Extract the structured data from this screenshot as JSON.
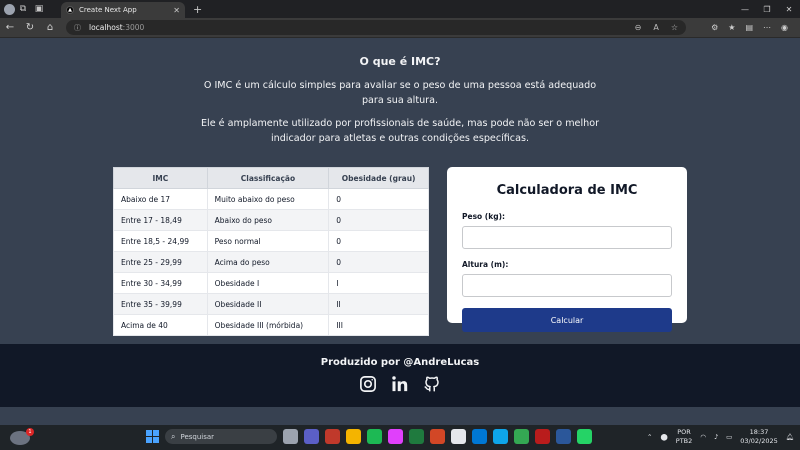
{
  "browser": {
    "tab_title": "Create Next App",
    "tab_favicon": "▲",
    "url_host": "localhost",
    "url_port": ":3000"
  },
  "intro": {
    "heading": "O que é IMC?",
    "paragraph1": "O IMC é um cálculo simples para avaliar se o peso de uma pessoa está adequado para sua altura.",
    "paragraph2": "Ele é amplamente utilizado por profissionais de saúde, mas pode não ser o melhor indicador para atletas e outras condições específicas."
  },
  "table": {
    "headers": [
      "IMC",
      "Classificação",
      "Obesidade (grau)"
    ],
    "rows": [
      [
        "Abaixo de 17",
        "Muito abaixo do peso",
        "0"
      ],
      [
        "Entre 17 - 18,49",
        "Abaixo do peso",
        "0"
      ],
      [
        "Entre 18,5 - 24,99",
        "Peso normal",
        "0"
      ],
      [
        "Entre 25 - 29,99",
        "Acima do peso",
        "0"
      ],
      [
        "Entre 30 - 34,99",
        "Obesidade I",
        "I"
      ],
      [
        "Entre 35 - 39,99",
        "Obesidade II",
        "II"
      ],
      [
        "Acima de 40",
        "Obesidade III (mórbida)",
        "III"
      ]
    ]
  },
  "calculator": {
    "title": "Calculadora de IMC",
    "weight_label": "Peso (kg):",
    "weight_value": "",
    "height_label": "Altura (m):",
    "height_value": "",
    "button_label": "Calcular"
  },
  "footer": {
    "credit": "Produzido por @AndreLucas",
    "socials": [
      "instagram-icon",
      "linkedin-icon",
      "github-icon"
    ]
  },
  "taskbar": {
    "search_label": "Pesquisar",
    "weather_badge": "1",
    "language_line1": "POR",
    "language_line2": "PTB2",
    "time": "18:37",
    "date": "03/02/2025"
  },
  "colors": {
    "page_bg": "#374151",
    "footer_bg": "#111827",
    "button_bg": "#1e3a8a"
  }
}
